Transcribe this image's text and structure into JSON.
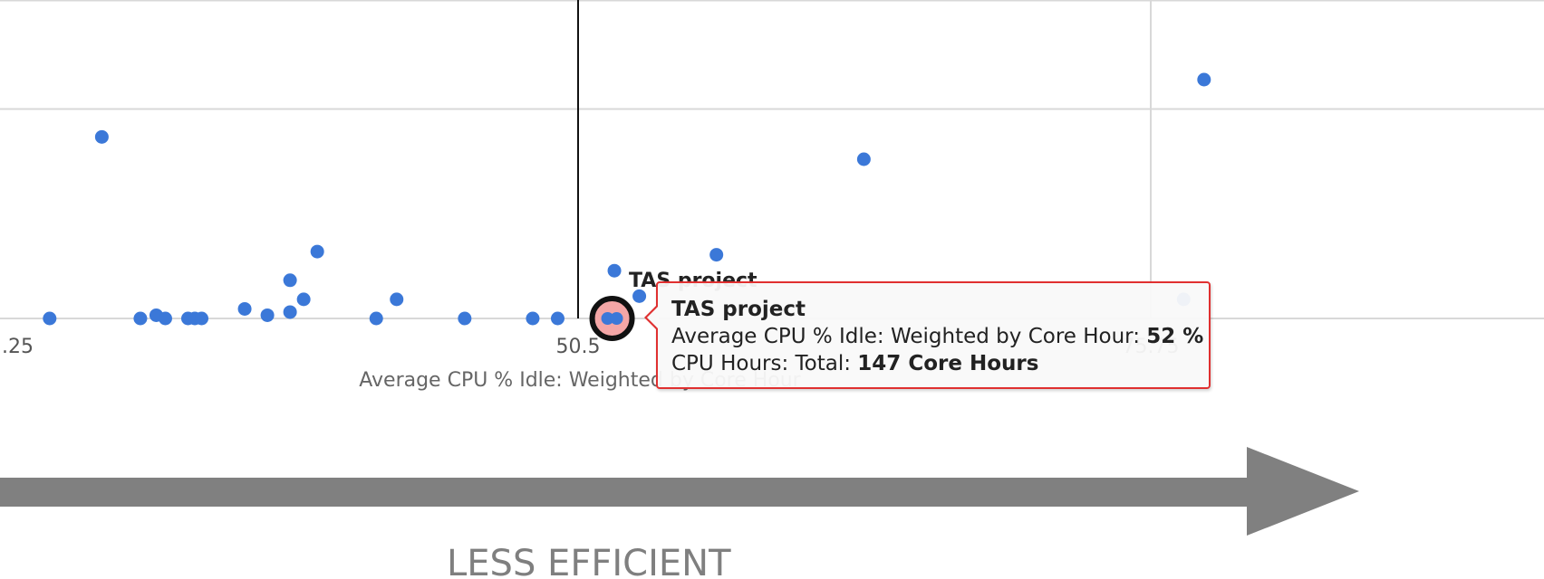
{
  "chart_data": {
    "type": "scatter",
    "xlabel": "Average CPU % Idle: Weighted by Core Hour",
    "x_ticks": [
      ".25",
      "50.5",
      "75.75"
    ],
    "xlim": [
      25,
      79
    ],
    "ylim": [
      0,
      100
    ],
    "grid": true,
    "reference_line_x": 50.5,
    "point_color": "#3b78d8",
    "points": [
      {
        "x": 27.2,
        "y": 0
      },
      {
        "x": 29.5,
        "y": 57
      },
      {
        "x": 31.2,
        "y": 0
      },
      {
        "x": 31.9,
        "y": 1
      },
      {
        "x": 32.3,
        "y": 0
      },
      {
        "x": 33.3,
        "y": 0
      },
      {
        "x": 33.6,
        "y": 0
      },
      {
        "x": 33.9,
        "y": 0
      },
      {
        "x": 35.8,
        "y": 3
      },
      {
        "x": 36.8,
        "y": 1
      },
      {
        "x": 37.8,
        "y": 12
      },
      {
        "x": 37.8,
        "y": 2
      },
      {
        "x": 38.4,
        "y": 6
      },
      {
        "x": 39.0,
        "y": 21
      },
      {
        "x": 41.6,
        "y": 0
      },
      {
        "x": 42.5,
        "y": 6
      },
      {
        "x": 45.5,
        "y": 0
      },
      {
        "x": 48.5,
        "y": 0
      },
      {
        "x": 49.6,
        "y": 0
      },
      {
        "x": 52.1,
        "y": 15
      },
      {
        "x": 52.0,
        "y": 0
      },
      {
        "x": 52.3,
        "y": 0
      },
      {
        "x": 53.2,
        "y": 7
      },
      {
        "x": 56.6,
        "y": 20
      },
      {
        "x": 63.1,
        "y": 50
      },
      {
        "x": 77.2,
        "y": 6
      },
      {
        "x": 78.1,
        "y": 75
      }
    ],
    "highlighted_point": {
      "x": 52.0,
      "y": 0,
      "label": "TAS project"
    }
  },
  "point_label": "TAS project",
  "tooltip": {
    "title": "TAS project",
    "line1_label": "Average CPU % Idle: Weighted by Core Hour: ",
    "line1_value": "52 %",
    "line2_label": "CPU Hours: Total: ",
    "line2_value": "147 Core Hours"
  },
  "direction_label": "LESS EFFICIENT",
  "colors": {
    "grid": "#d8d8d8",
    "reference_line": "#111111",
    "arrow": "#808080",
    "tooltip_border": "#e03030",
    "highlight_fill": "#f4a6a6"
  }
}
